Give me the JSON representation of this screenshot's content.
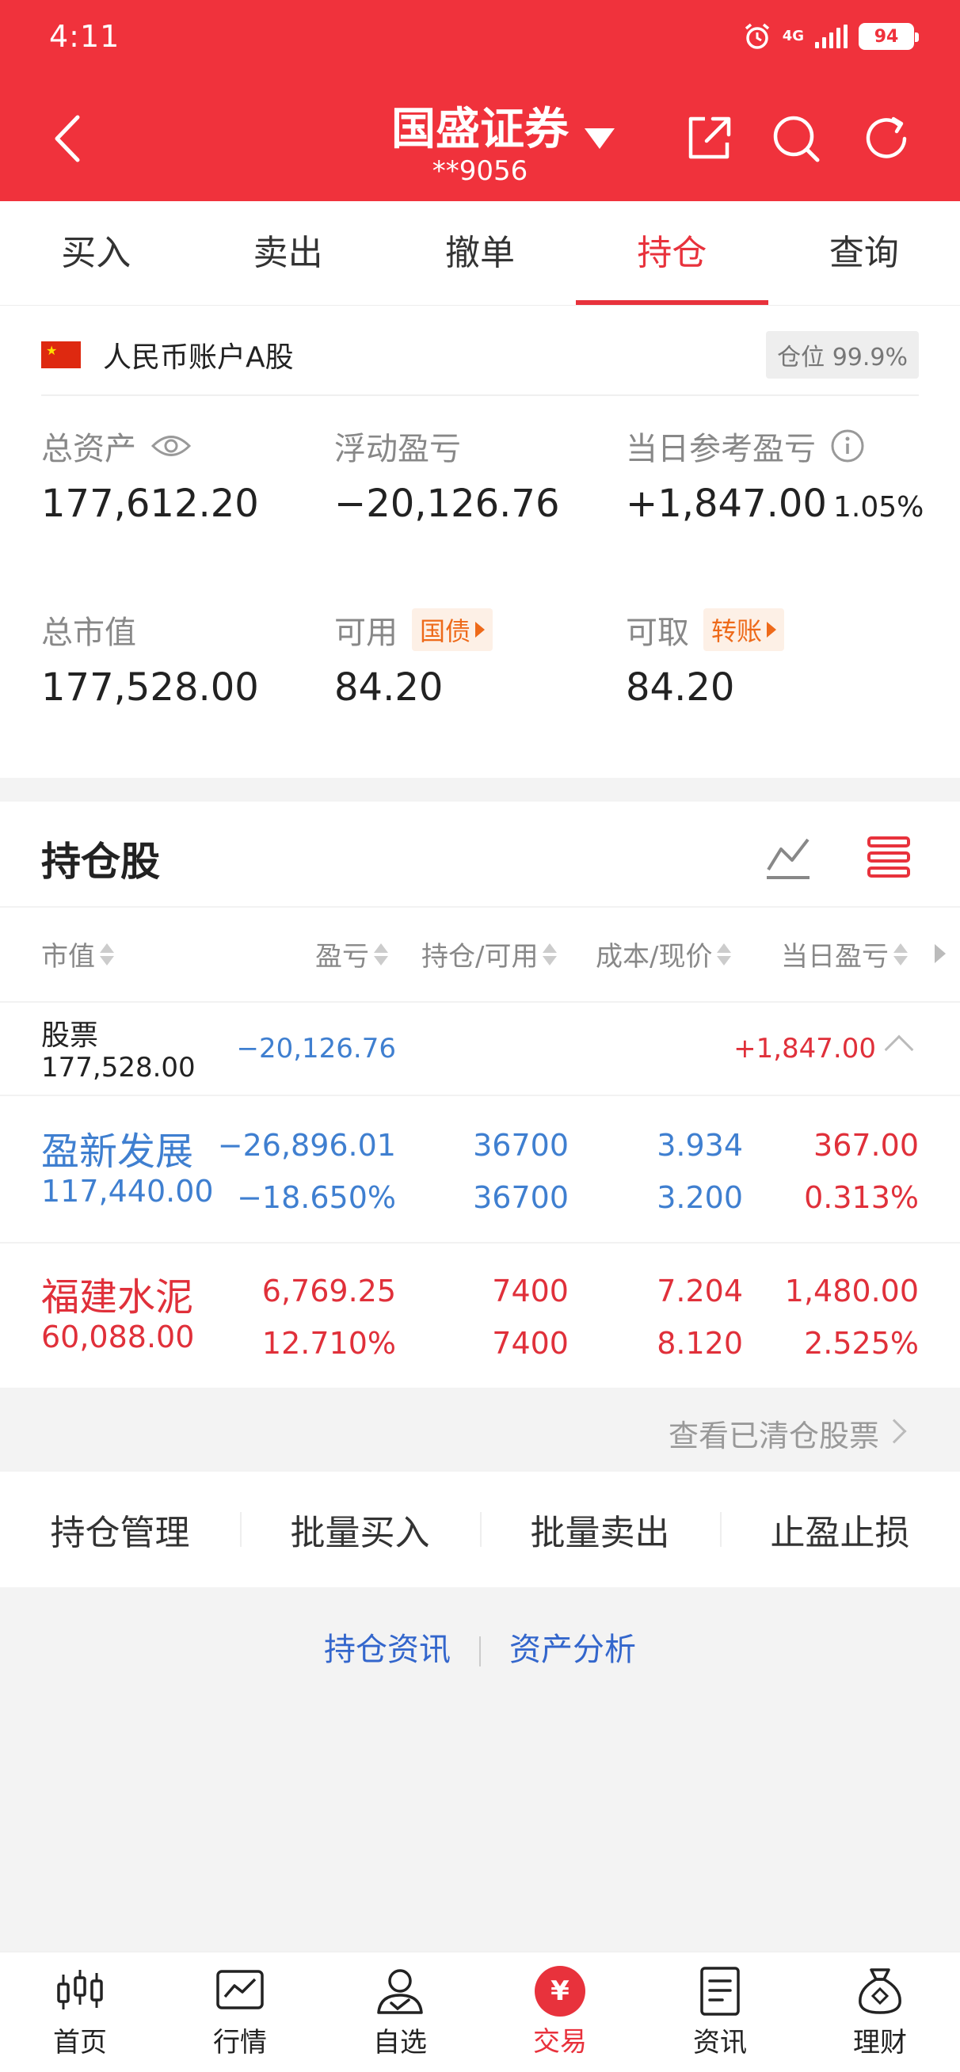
{
  "status_bar": {
    "time": "4:11",
    "network": "4G",
    "battery": "94"
  },
  "header": {
    "broker_name": "国盛证券",
    "account_no": "**9056"
  },
  "tabs": [
    {
      "label": "买入"
    },
    {
      "label": "卖出"
    },
    {
      "label": "撤单"
    },
    {
      "label": "持仓",
      "active": true
    },
    {
      "label": "查询"
    }
  ],
  "account": {
    "currency_label": "人民币账户A股",
    "position_badge": "仓位 99.9%",
    "total_assets_label": "总资产",
    "total_assets": "177,612.20",
    "floating_pl_label": "浮动盈亏",
    "floating_pl": "−20,126.76",
    "daily_pl_label": "当日参考盈亏",
    "daily_pl": "+1,847.00",
    "daily_pl_pct": "1.05%",
    "market_value_label": "总市值",
    "market_value": "177,528.00",
    "available_label": "可用",
    "available_tag": "国债",
    "available": "84.20",
    "withdrawable_label": "可取",
    "withdrawable_tag": "转账",
    "withdrawable": "84.20"
  },
  "holdings": {
    "title": "持仓股",
    "columns": [
      "市值",
      "盈亏",
      "持仓/可用",
      "成本/现价",
      "当日盈亏"
    ],
    "summary": {
      "name": "股票",
      "market_value": "177,528.00",
      "pl": "−20,126.76",
      "daily_pl": "+1,847.00"
    },
    "stocks": [
      {
        "name": "盈新发展",
        "market_value": "117,440.00",
        "pl": "−26,896.01",
        "pl_pct": "−18.650%",
        "position": "36700",
        "available": "36700",
        "cost": "3.934",
        "price": "3.200",
        "daily_pl": "367.00",
        "daily_pl_pct": "0.313%"
      },
      {
        "name": "福建水泥",
        "market_value": "60,088.00",
        "pl": "6,769.25",
        "pl_pct": "12.710%",
        "position": "7400",
        "available": "7400",
        "cost": "7.204",
        "price": "8.120",
        "daily_pl": "1,480.00",
        "daily_pl_pct": "2.525%"
      }
    ],
    "cleared_link": "查看已清仓股票"
  },
  "actions": [
    "持仓管理",
    "批量买入",
    "批量卖出",
    "止盈止损"
  ],
  "links": [
    "持仓资讯",
    "资产分析"
  ],
  "bottom_nav": [
    {
      "label": "首页",
      "icon": "candlestick-icon"
    },
    {
      "label": "行情",
      "icon": "market-chart-icon"
    },
    {
      "label": "自选",
      "icon": "user-check-icon"
    },
    {
      "label": "交易",
      "icon": "yuan-icon",
      "active": true
    },
    {
      "label": "资讯",
      "icon": "document-icon"
    },
    {
      "label": "理财",
      "icon": "money-bag-icon"
    }
  ],
  "colors": {
    "brand_red": "#f0323c",
    "loss_blue": "#3f7fd0",
    "gain_red": "#e0303a"
  }
}
